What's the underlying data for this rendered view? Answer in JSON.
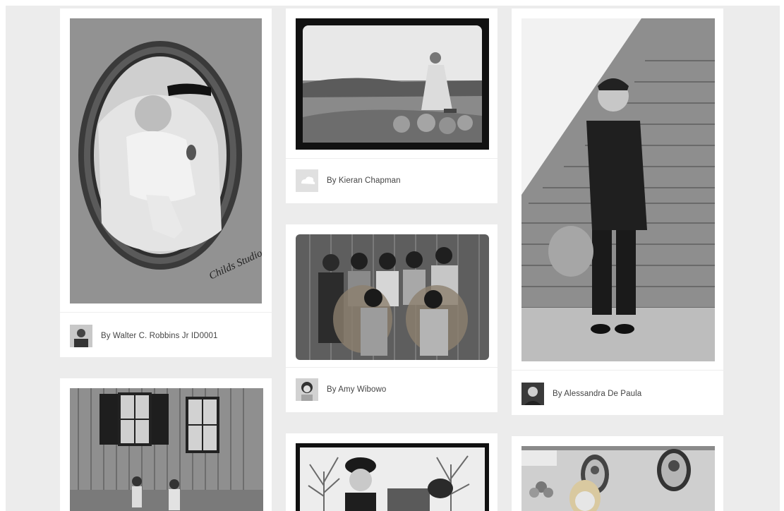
{
  "gallery": {
    "cards": [
      {
        "author": "By Walter C. Robbins Jr ID0001",
        "photo": "baby-portrait-photo",
        "studio_signature": "Childs Studio"
      },
      {
        "author": "By Kieran Chapman",
        "photo": "woman-on-rocks-photo"
      },
      {
        "author": "By Alessandra De Paula",
        "photo": "boy-on-stairs-photo"
      },
      {
        "author": "By Amy Wibowo",
        "photo": "family-group-photo"
      },
      {
        "author": "",
        "photo": "wooden-barn-photo"
      },
      {
        "author": "",
        "photo": "child-in-cap-photo"
      },
      {
        "author": "",
        "photo": "portrait-wall-photo"
      }
    ]
  },
  "colors": {
    "background": "#ececec",
    "card": "#ffffff",
    "caption_text": "#444444"
  }
}
